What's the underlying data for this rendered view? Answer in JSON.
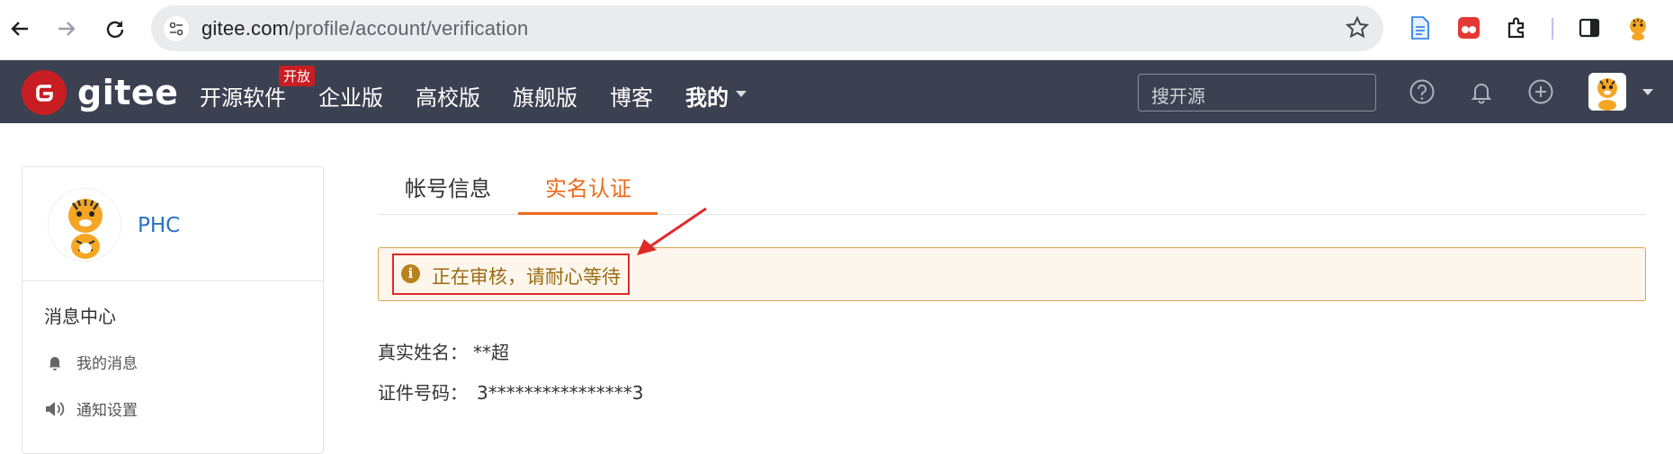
{
  "browser": {
    "url_host": "gitee.com",
    "url_path": "/profile/account/verification"
  },
  "header": {
    "logo_text": "gitee",
    "nav": [
      {
        "label": "开源软件"
      },
      {
        "label": "企业版"
      },
      {
        "label": "高校版"
      },
      {
        "label": "旗舰版"
      },
      {
        "label": "博客"
      },
      {
        "label": "我的"
      }
    ],
    "hot_badge": "开放",
    "search_placeholder": "搜开源"
  },
  "sidebar": {
    "username": "PHC",
    "section_title": "消息中心",
    "items": [
      {
        "label": "我的消息",
        "icon": "bell-icon"
      },
      {
        "label": "通知设置",
        "icon": "speaker-icon"
      }
    ]
  },
  "main": {
    "tabs": [
      {
        "label": "帐号信息",
        "active": false
      },
      {
        "label": "实名认证",
        "active": true
      }
    ],
    "notice": "正在审核，请耐心等待",
    "fields": [
      {
        "label": "真实姓名：",
        "value": "**超"
      },
      {
        "label": "证件号码：",
        "value": "3****************3"
      }
    ]
  },
  "colors": {
    "header_bg": "#3b4150",
    "accent": "#ed6a1c",
    "brand_red": "#c71d23",
    "notice_bg": "#fdf6ec",
    "notice_text": "#9a6b14",
    "annotation_red": "#e02a2a"
  }
}
